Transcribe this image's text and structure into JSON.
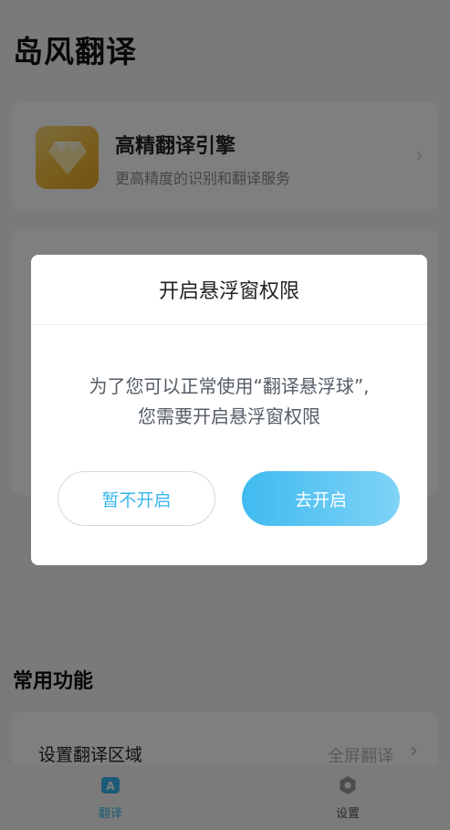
{
  "app": {
    "title": "岛风翻译"
  },
  "engine_card": {
    "title": "高精翻译引擎",
    "subtitle": "更高精度的识别和翻译服务",
    "chevron": "›"
  },
  "common": {
    "section_title": "常用功能",
    "setting_label": "设置翻译区域",
    "setting_value": "全屏翻译",
    "chevron": "›"
  },
  "tabbar": {
    "tabs": [
      {
        "label": "翻译",
        "icon": "translate-icon",
        "active": true
      },
      {
        "label": "设置",
        "icon": "gear-icon",
        "active": false
      }
    ]
  },
  "dialog": {
    "title": "开启悬浮窗权限",
    "message_line1": "为了您可以正常使用“翻译悬浮球”,",
    "message_line2": "您需要开启悬浮窗权限",
    "cancel_label": "暂不开启",
    "confirm_label": "去开启"
  },
  "colors": {
    "accent": "#38b6ee",
    "overlay": "rgba(0,0,0,0.5)"
  }
}
